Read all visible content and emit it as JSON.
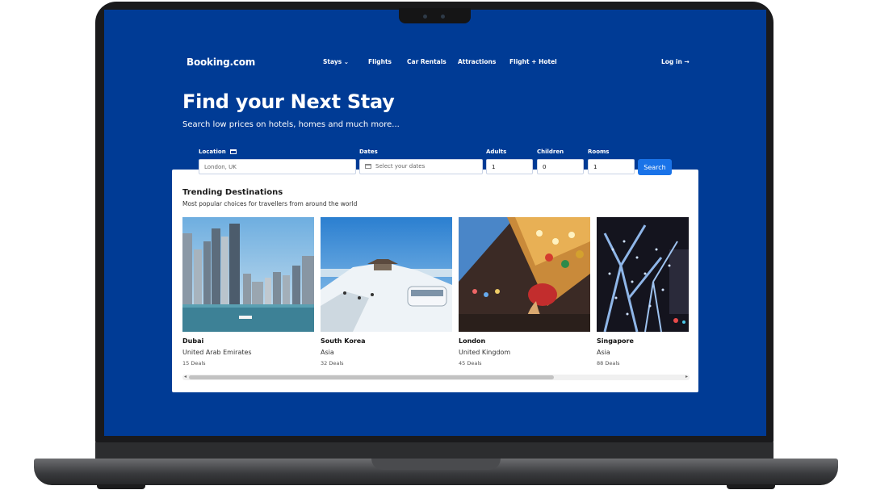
{
  "brand": {
    "logo": "Booking.com"
  },
  "nav": {
    "items": [
      {
        "label": "Stays ⌄"
      },
      {
        "label": "Flights"
      },
      {
        "label": "Car Rentals"
      },
      {
        "label": "Attractions"
      },
      {
        "label": "Flight + Hotel"
      }
    ],
    "login": "Log in →"
  },
  "hero": {
    "title": "Find your Next Stay",
    "subtitle": "Search low prices on hotels, homes and much more..."
  },
  "search": {
    "location_label": "Location",
    "location_value": "London, UK",
    "dates_label": "Dates",
    "dates_placeholder": "Select your dates",
    "adults_label": "Adults",
    "adults_value": "1",
    "children_label": "Children",
    "children_value": "0",
    "rooms_label": "Rooms",
    "rooms_value": "1",
    "button": "Search"
  },
  "trending": {
    "title": "Trending Destinations",
    "subtitle": "Most popular choices for travellers from around the world",
    "destinations": [
      {
        "name": "Dubai",
        "country": "United Arab Emirates",
        "deals": "15 Deals"
      },
      {
        "name": "South Korea",
        "country": "Asia",
        "deals": "32 Deals"
      },
      {
        "name": "London",
        "country": "United Kingdom",
        "deals": "45 Deals"
      },
      {
        "name": "Singapore",
        "country": "Asia",
        "deals": "88 Deals"
      }
    ]
  },
  "colors": {
    "brand_blue": "#003b95",
    "button_blue": "#1a73e8"
  }
}
